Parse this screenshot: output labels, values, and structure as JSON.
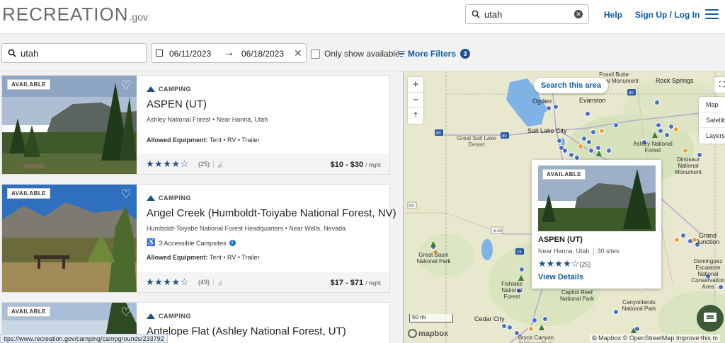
{
  "header": {
    "logo_text": "RECREATION",
    "logo_gov": ".gov",
    "search_value": "utah",
    "help_label": "Help",
    "signup_label": "Sign Up / Log In"
  },
  "filters": {
    "location_value": "utah",
    "start_date": "06/11/2023",
    "end_date": "06/18/2023",
    "only_available_label": "Only show available",
    "more_filters_label": "More Filters",
    "more_filters_count": "3"
  },
  "results": [
    {
      "badge": "AVAILABLE",
      "category": "CAMPING",
      "title": "ASPEN (UT)",
      "subtitle": "Ashley National Forest • Near Hanna, Utah",
      "equipment_label": "Allowed Equipment:",
      "equipment": "Tent • RV • Trailer",
      "rating": 3.5,
      "stars": "★★★★☆",
      "review_count": "(25)",
      "price": "$10 - $30",
      "price_unit": "/ night"
    },
    {
      "badge": "AVAILABLE",
      "category": "CAMPING",
      "title": "Angel Creek (Humboldt-Toiyabe National Forest, NV)",
      "subtitle": "Humboldt-Toiyabe National Forest Headquarters • Near Wells, Nevada",
      "accessible": "3 Accessible Campsites",
      "equipment_label": "Allowed Equipment:",
      "equipment": "Tent • RV • Trailer",
      "rating": 3.5,
      "stars": "★★★★☆",
      "review_count": "(49)",
      "price": "$17 - $71",
      "price_unit": "/ night"
    },
    {
      "badge": "AVAILABLE",
      "category": "CAMPING",
      "title": "Antelope Flat (Ashley National Forest, UT)"
    }
  ],
  "status_url": "ttps://www.recreation.gov/camping/campgrounds/233792",
  "map": {
    "search_area_label": "Search this area",
    "layer_options": [
      "Map",
      "Satellite",
      "Layers"
    ],
    "scale_label": "50 mi",
    "mapbox_label": "mapbox",
    "attribution": "© Mapbox © OpenStreetMap Improve this m",
    "labels": {
      "ogden": "Ogden",
      "evanston": "Evanston",
      "slc": "Salt Lake City",
      "gsl_desert": "Great Salt Lake Desert",
      "fossil_butte": "Fossil Butte National Monument",
      "rock_springs": "Rock Springs",
      "ashley": "Ashley National Forest",
      "dinosaur": "Dinosaur National Monument",
      "great_basin": "Great Basin National Park",
      "fishlake": "Fishlake National Forest",
      "capitol_reef": "Capitol Reef National Park",
      "canyonlands": "Canyonlands National Park",
      "grand_junction": "Grand Junction",
      "dominguez": "Dominguez Escalante National Conservation Area",
      "cedar_city": "Cedar City",
      "bryce": "Bryce Canyon National Park"
    },
    "popup": {
      "badge": "AVAILABLE",
      "title": "ASPEN (UT)",
      "location": "Near Hanna, Utah",
      "sites": "30 sites",
      "stars": "★★★★☆",
      "review_count": "(25)",
      "link": "View Details"
    }
  },
  "colors": {
    "link_blue": "#0e5ca8",
    "star_blue": "#1e4f86",
    "map_bg": "#e9ead2",
    "marker_blue": "#4a6fc4",
    "marker_orange": "#f0a030"
  }
}
